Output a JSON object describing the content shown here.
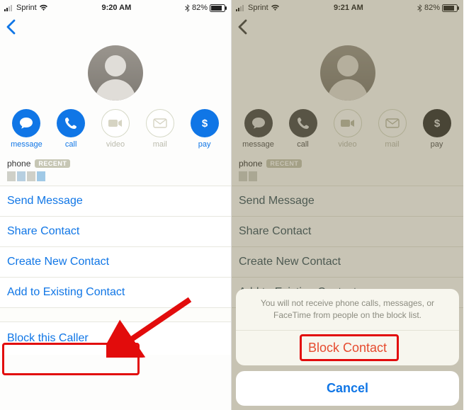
{
  "left": {
    "status": {
      "carrier": "Sprint",
      "time": "9:20 AM",
      "battery": "82%"
    },
    "actions": {
      "message": "message",
      "call": "call",
      "video": "video",
      "mail": "mail",
      "pay": "pay"
    },
    "phone_label": "phone",
    "recent_badge": "RECENT",
    "items": {
      "send_message": "Send Message",
      "share_contact": "Share Contact",
      "create_new": "Create New Contact",
      "add_existing": "Add to Existing Contact",
      "block": "Block this Caller"
    }
  },
  "right": {
    "status": {
      "carrier": "Sprint",
      "time": "9:21 AM",
      "battery": "82%"
    },
    "actions": {
      "message": "message",
      "call": "call",
      "video": "video",
      "mail": "mail",
      "pay": "pay"
    },
    "phone_label": "phone",
    "recent_badge": "RECENT",
    "items": {
      "send_message": "Send Message",
      "share_contact": "Share Contact",
      "create_new": "Create New Contact",
      "add_existing": "Add to Existing Contact"
    },
    "sheet": {
      "message": "You will not receive phone calls, messages, or FaceTime from people on the block list.",
      "block": "Block Contact",
      "cancel": "Cancel"
    }
  }
}
